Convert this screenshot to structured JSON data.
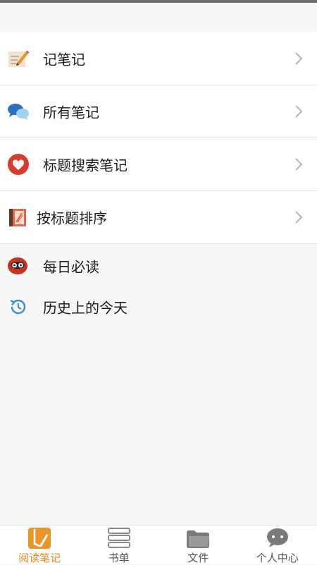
{
  "menu": {
    "items": [
      {
        "label": "记笔记",
        "icon": "pencil-note-icon"
      },
      {
        "label": "所有笔记",
        "icon": "chat-bubbles-icon"
      },
      {
        "label": "标题搜索笔记",
        "icon": "heart-icon"
      },
      {
        "label": "按标题排序",
        "icon": "book-icon"
      }
    ]
  },
  "extras": {
    "items": [
      {
        "label": "每日必读",
        "icon": "owl-icon"
      },
      {
        "label": "历史上的今天",
        "icon": "history-icon"
      }
    ]
  },
  "tabbar": {
    "tabs": [
      {
        "label": "阅读笔记",
        "icon": "reading-notes-icon",
        "active": true
      },
      {
        "label": "书单",
        "icon": "book-list-icon",
        "active": false
      },
      {
        "label": "文件",
        "icon": "folder-icon",
        "active": false
      },
      {
        "label": "个人中心",
        "icon": "chat-profile-icon",
        "active": false
      }
    ]
  },
  "colors": {
    "accent": "#e58a1f",
    "tab_inactive": "#555555",
    "background": "#f7f7f7"
  }
}
